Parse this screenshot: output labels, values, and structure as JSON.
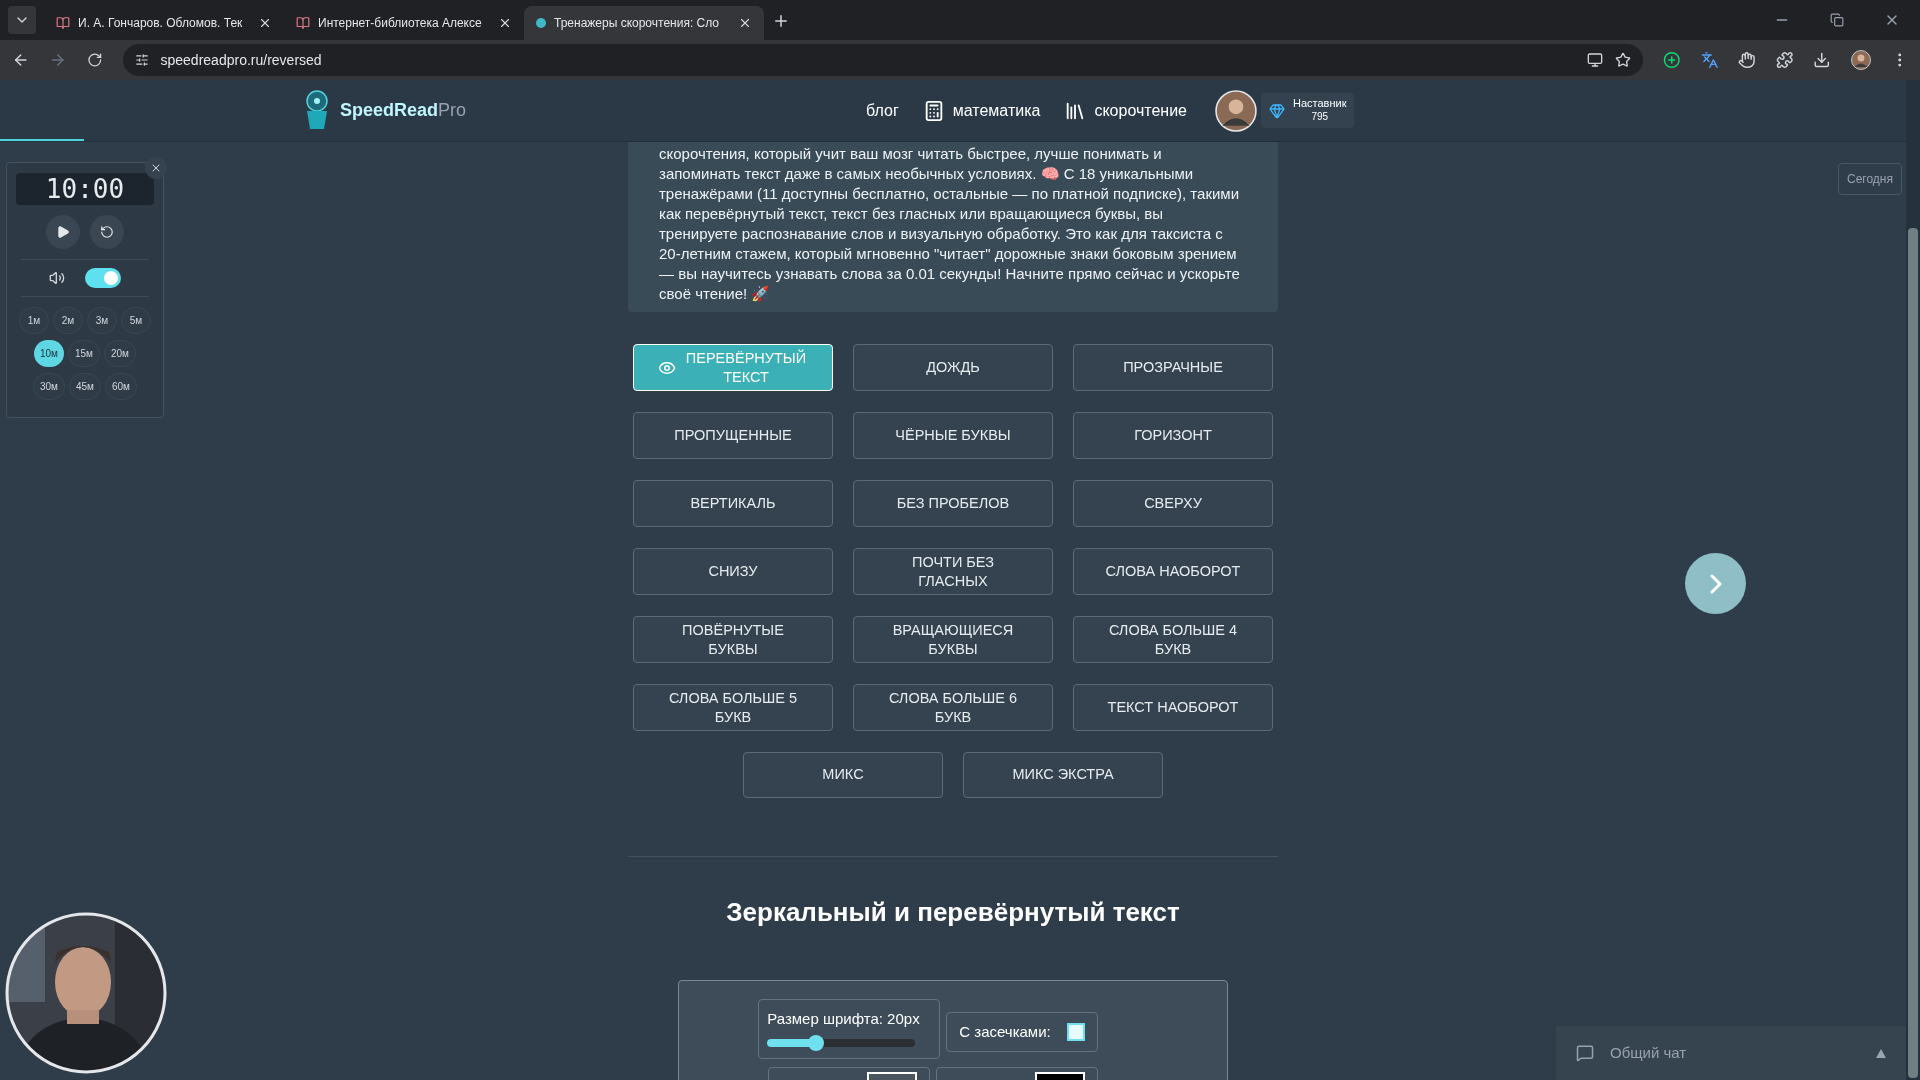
{
  "browser": {
    "tabs": [
      {
        "title": "И. А. Гончаров. Обломов. Тек",
        "kind": "book",
        "selected": false
      },
      {
        "title": "Интернет-библиотека Алексе",
        "kind": "book",
        "selected": false
      },
      {
        "title": "Тренажеры скорочтения: Сло",
        "kind": "site",
        "selected": true
      }
    ],
    "url": "speedreadpro.ru/reversed"
  },
  "header": {
    "logo_main": "SpeedRead",
    "logo_suffix": "Pro",
    "nav": [
      {
        "label": "блог",
        "kind": "text"
      },
      {
        "label": "математика",
        "kind": "calculator"
      },
      {
        "label": "скорочтение",
        "kind": "books"
      }
    ],
    "badge": {
      "title": "Наставник",
      "points": "795"
    }
  },
  "intro": "скорочтения, который учит ваш мозг читать быстрее, лучше понимать и запоминать текст даже в самых необычных условиях. 🧠 С 18 уникальными тренажёрами (11 доступны бесплатно, остальные — по платной подписке), такими как перевёрнутый текст, текст без гласных или вращающиеся буквы, вы тренируете распознавание слов и визуальную обработку. Это как для таксиста с 20-летним стажем, который мгновенно \"читает\" дорожные знаки боковым зрением — вы научитесь узнавать слова за 0.01 секунды! Начните прямо сейчас и ускорьте своё чтение! 🚀",
  "timer": {
    "display": "10:00",
    "sound_on": true,
    "preset_rows": [
      [
        {
          "label": "1м",
          "selected": false
        },
        {
          "label": "2м",
          "selected": false
        },
        {
          "label": "3м",
          "selected": false
        },
        {
          "label": "5м",
          "selected": false
        }
      ],
      [
        {
          "label": "10м",
          "selected": true
        },
        {
          "label": "15м",
          "selected": false
        },
        {
          "label": "20м",
          "selected": false
        }
      ],
      [
        {
          "label": "30м",
          "selected": false
        },
        {
          "label": "45м",
          "selected": false
        },
        {
          "label": "60м",
          "selected": false
        }
      ]
    ]
  },
  "trainers": [
    {
      "label": "ПЕРЕВЁРНУТЫЙ ТЕКСТ",
      "selected": true
    },
    {
      "label": "ДОЖДЬ",
      "selected": false
    },
    {
      "label": "ПРОЗРАЧНЫЕ",
      "selected": false
    },
    {
      "label": "ПРОПУЩЕННЫЕ",
      "selected": false
    },
    {
      "label": "ЧЁРНЫЕ БУКВЫ",
      "selected": false
    },
    {
      "label": "ГОРИЗОНТ",
      "selected": false
    },
    {
      "label": "ВЕРТИКАЛЬ",
      "selected": false
    },
    {
      "label": "БЕЗ ПРОБЕЛОВ",
      "selected": false
    },
    {
      "label": "СВЕРХУ",
      "selected": false
    },
    {
      "label": "СНИЗУ",
      "selected": false
    },
    {
      "label": "ПОЧТИ БЕЗ ГЛАСНЫХ",
      "selected": false
    },
    {
      "label": "СЛОВА НАОБОРОТ",
      "selected": false
    },
    {
      "label": "ПОВЁРНУТЫЕ БУКВЫ",
      "selected": false
    },
    {
      "label": "ВРАЩАЮЩИЕСЯ БУКВЫ",
      "selected": false
    },
    {
      "label": "СЛОВА БОЛЬШЕ 4 БУКВ",
      "selected": false
    },
    {
      "label": "СЛОВА БОЛЬШЕ 5 БУКВ",
      "selected": false
    },
    {
      "label": "СЛОВА БОЛЬШЕ 6 БУКВ",
      "selected": false
    },
    {
      "label": "ТЕКСТ НАОБОРОТ",
      "selected": false
    }
  ],
  "mix_trainers": [
    {
      "label": "МИКС",
      "selected": false
    },
    {
      "label": "МИКС ЭКСТРА",
      "selected": false
    }
  ],
  "section_title": "Зеркальный и перевёрнутый текст",
  "settings": {
    "font_size_label": "Размер шрифта: 20px",
    "level": 0.33,
    "serif_label": "С засечками:",
    "serif_checked": false
  },
  "today_button": "Сегодня",
  "chat": {
    "title": "Общий чат"
  }
}
